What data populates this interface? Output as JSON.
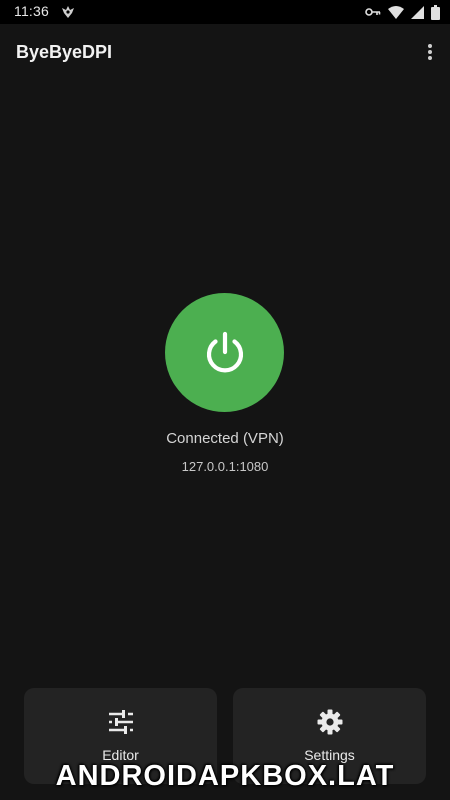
{
  "status_bar": {
    "time": "11:36",
    "icons": [
      "app-notification-icon",
      "vpn-key-icon",
      "wifi-icon",
      "signal-icon",
      "battery-icon"
    ]
  },
  "app_bar": {
    "title": "ByeByeDPI",
    "menu_icon": "more-vert-icon"
  },
  "main": {
    "power_icon": "power-icon",
    "power_color": "#4caf50",
    "status": "Connected (VPN)",
    "address": "127.0.0.1:1080"
  },
  "bottom_actions": {
    "editor": {
      "label": "Editor",
      "icon": "tune-icon"
    },
    "settings": {
      "label": "Settings",
      "icon": "gear-icon"
    }
  },
  "watermark": "ANDROIDAPKBOX.LAT"
}
